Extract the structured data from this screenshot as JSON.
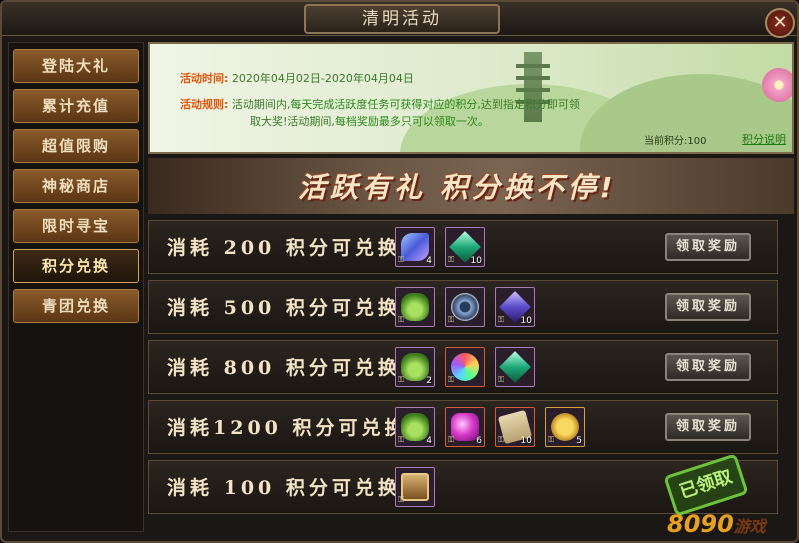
{
  "window": {
    "title": "清明活动",
    "close_label": "✕"
  },
  "sidebar": {
    "items": [
      {
        "label": "登陆大礼",
        "active": false
      },
      {
        "label": "累计充值",
        "active": false
      },
      {
        "label": "超值限购",
        "active": false
      },
      {
        "label": "神秘商店",
        "active": false
      },
      {
        "label": "限时寻宝",
        "active": false
      },
      {
        "label": "积分兑换",
        "active": true
      },
      {
        "label": "青团兑换",
        "active": false
      }
    ]
  },
  "info": {
    "time_label": "活动时间:",
    "time_value": "2020年04月02日-2020年04月04日",
    "rules_label": "活动规则:",
    "rules_line1_a": "活动期间内,",
    "rules_line1_b": "每天完成活跃度任务可获得对应的积分,",
    "rules_line1_c": "达到指定积分即可领",
    "rules_line2_a": "取大奖!",
    "rules_line2_b": "活动期间,",
    "rules_line2_c": "每档奖励最多只可以领取一次。",
    "points_text": "当前积分:100",
    "rules_link": "积分说明"
  },
  "banner": {
    "text": "活跃有礼 积分换不停!"
  },
  "rewards": [
    {
      "label": "消耗 200 积分可兑换",
      "button": "领取奖励",
      "items": [
        {
          "icon": "feather-icon",
          "count": "4"
        },
        {
          "icon": "green-crystal-icon",
          "count": "10"
        }
      ]
    },
    {
      "label": "消耗 500 积分可兑换",
      "button": "领取奖励",
      "items": [
        {
          "icon": "herb-icon",
          "count": ""
        },
        {
          "icon": "compass-disc-icon",
          "count": ""
        },
        {
          "icon": "purple-crystal-icon",
          "count": "10"
        }
      ]
    },
    {
      "label": "消耗 800 积分可兑换",
      "button": "领取奖励",
      "items": [
        {
          "icon": "herb-icon",
          "count": "2"
        },
        {
          "icon": "rainbow-orb-icon",
          "count": ""
        },
        {
          "icon": "green-crystal-icon",
          "count": ""
        }
      ]
    },
    {
      "label": "消耗1200 积分可兑换",
      "button": "领取奖励",
      "items": [
        {
          "icon": "herb-icon",
          "count": "4"
        },
        {
          "icon": "pink-gem-icon",
          "count": "6"
        },
        {
          "icon": "scroll-icon",
          "count": "10"
        },
        {
          "icon": "gold-coin-icon",
          "count": "5"
        }
      ]
    },
    {
      "label": "消耗 100 积分可兑换",
      "button": "",
      "items": [
        {
          "icon": "treasure-chest-icon",
          "count": ""
        }
      ]
    }
  ],
  "stamp": {
    "text": "已领取"
  },
  "watermark": {
    "number": "8090",
    "text": "游戏"
  },
  "colors": {
    "accent_orange": "#e0560a",
    "rule_green": "#2a8a18",
    "gold_text": "#f2e4c4"
  }
}
